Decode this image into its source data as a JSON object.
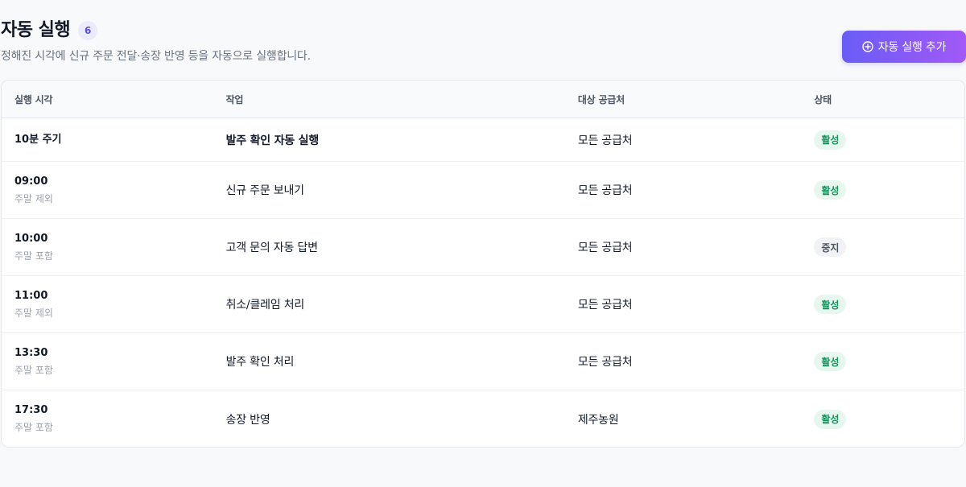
{
  "header": {
    "title": "자동 실행",
    "count": "6",
    "subtitle": "정해진 시각에 신규 주문 전달·송장 반영 등을 자동으로 실행합니다.",
    "add_button_label": "자동 실행 추가",
    "add_button_icon": "plus-circle-icon"
  },
  "colors": {
    "accent_start": "#6a5cf6",
    "accent_end": "#a259f7",
    "active_bg": "#e7f7ef",
    "active_text": "#15935b",
    "stopped_bg": "#f1f2f4",
    "stopped_text": "#4b5563"
  },
  "table": {
    "columns": [
      "실행 시각",
      "작업",
      "대상 공급처",
      "상태"
    ],
    "rows": [
      {
        "time": "10분 주기",
        "sub": "",
        "task": "발주 확인 자동 실행",
        "target": "모든 공급처",
        "status": "활성"
      },
      {
        "time": "09:00",
        "sub": "주말 제외",
        "task": "신규 주문 보내기",
        "target": "모든 공급처",
        "status": "활성"
      },
      {
        "time": "10:00",
        "sub": "주말 포함",
        "task": "고객 문의 자동 답변",
        "target": "모든 공급처",
        "status": "중지"
      },
      {
        "time": "11:00",
        "sub": "주말 제외",
        "task": "취소/클레임 처리",
        "target": "모든 공급처",
        "status": "활성"
      },
      {
        "time": "13:30",
        "sub": "주말 포함",
        "task": "발주 확인 처리",
        "target": "모든 공급처",
        "status": "활성"
      },
      {
        "time": "17:30",
        "sub": "주말 포함",
        "task": "송장 반영",
        "target": "제주농원",
        "status": "활성"
      }
    ]
  }
}
